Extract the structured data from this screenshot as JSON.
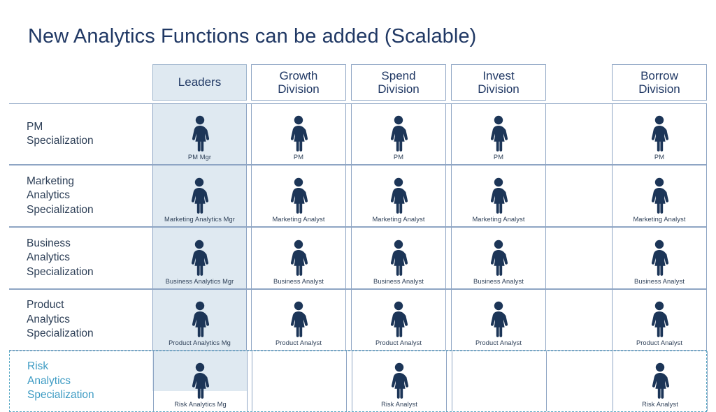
{
  "title": "New Analytics Functions can be added (Scalable)",
  "colors": {
    "title": "#203864",
    "figure": "#1c3557",
    "grid_line": "#8ea5c4",
    "highlight_band": "#dfe9f1",
    "dashed_accent": "#57a8c4",
    "risk_label": "#3f9cc4",
    "cell_text": "#2c3e56"
  },
  "columns": [
    {
      "key": "row_label",
      "label": "",
      "highlight": false,
      "has_header_box": false
    },
    {
      "key": "leaders",
      "label": "Leaders",
      "highlight": true,
      "has_header_box": true
    },
    {
      "key": "growth",
      "label": "Growth Division",
      "highlight": false,
      "has_header_box": true
    },
    {
      "key": "spend",
      "label": "Spend Division",
      "highlight": false,
      "has_header_box": true
    },
    {
      "key": "invest",
      "label": "Invest Division",
      "highlight": false,
      "has_header_box": true
    },
    {
      "key": "gap",
      "label": "",
      "highlight": false,
      "has_header_box": false
    },
    {
      "key": "borrow",
      "label": "Borrow Division",
      "highlight": false,
      "has_header_box": true
    }
  ],
  "rows": [
    {
      "key": "pm",
      "label_lines": [
        "PM",
        "Specialization"
      ],
      "style": "solid",
      "cells": {
        "leaders": "PM Mgr",
        "growth": "PM",
        "spend": "PM",
        "invest": "PM",
        "gap": "",
        "borrow": "PM"
      }
    },
    {
      "key": "marketing",
      "label_lines": [
        "Marketing",
        "Analytics",
        "Specialization"
      ],
      "style": "solid",
      "cells": {
        "leaders": "Marketing Analytics Mgr",
        "growth": "Marketing Analyst",
        "spend": "Marketing Analyst",
        "invest": "Marketing Analyst",
        "gap": "",
        "borrow": "Marketing Analyst"
      }
    },
    {
      "key": "business",
      "label_lines": [
        "Business",
        "Analytics",
        "Specialization"
      ],
      "style": "solid",
      "cells": {
        "leaders": "Business Analytics Mgr",
        "growth": "Business Analyst",
        "spend": "Business Analyst",
        "invest": "Business Analyst",
        "gap": "",
        "borrow": "Business Analyst"
      }
    },
    {
      "key": "product",
      "label_lines": [
        "Product",
        "Analytics",
        "Specialization"
      ],
      "style": "solid",
      "cells": {
        "leaders": "Product Analytics Mg",
        "growth": "Product Analyst",
        "spend": "Product Analyst",
        "invest": "Product Analyst",
        "gap": "",
        "borrow": "Product Analyst"
      }
    },
    {
      "key": "risk",
      "label_lines": [
        "Risk",
        "Analytics",
        "Specialization"
      ],
      "style": "dashed",
      "cells": {
        "leaders": "Risk Analytics Mg",
        "growth": "",
        "spend": "Risk Analyst",
        "invest": "",
        "gap": "",
        "borrow": "Risk Analyst"
      }
    }
  ],
  "icon": {
    "name": "person-figure-icon"
  }
}
